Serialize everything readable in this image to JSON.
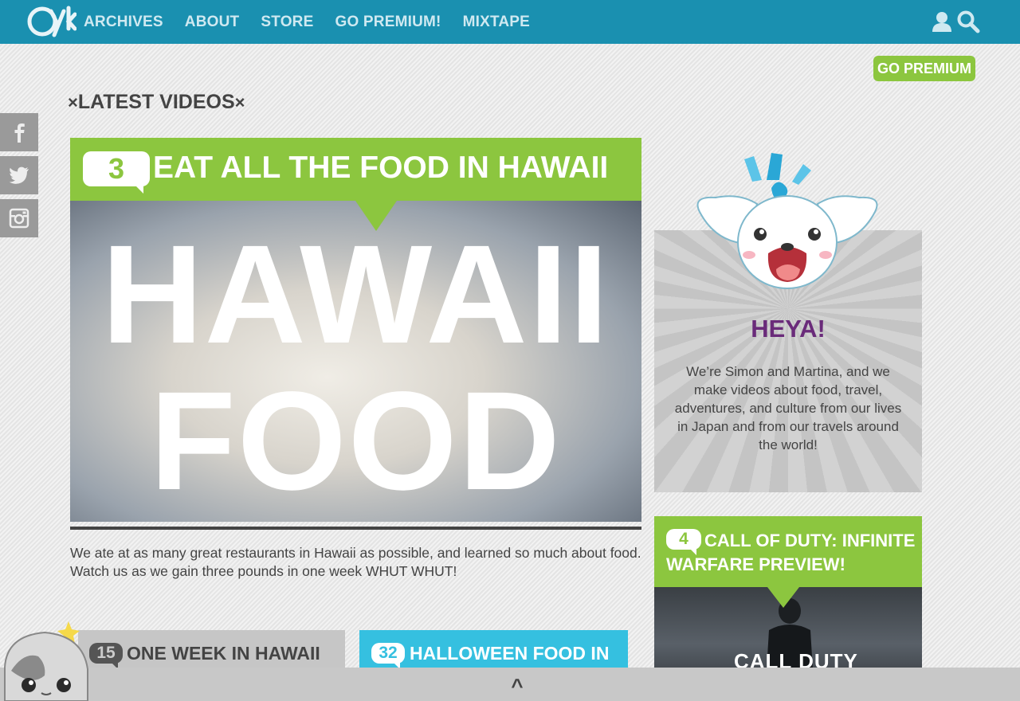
{
  "nav": {
    "logo_alt": "Zyk",
    "links": [
      "ARCHIVES",
      "ABOUT",
      "STORE",
      "GO PREMIUM!",
      "MIXTAPE"
    ],
    "icons": [
      "user-icon",
      "search-icon"
    ]
  },
  "premium_button": "GO PREMIUM",
  "section": {
    "title": "LATEST VIDEOS",
    "x_left": "×",
    "x_right": "×"
  },
  "social": [
    "facebook-icon",
    "twitter-icon",
    "instagram-icon"
  ],
  "featured": {
    "comments": "3",
    "title": "EAT ALL THE FOOD IN HAWAII",
    "image_text_1": "HAWAII",
    "image_text_2": "FOOD",
    "description": "We ate at as many great restaurants in Hawaii as possible, and learned so much about food. Watch us as we gain three pounds in one week WHUT WHUT!"
  },
  "cards": [
    {
      "comments": "15",
      "title": "ONE WEEK IN HAWAII"
    },
    {
      "comments": "32",
      "title": "HALLOWEEN FOOD IN"
    }
  ],
  "about": {
    "heading": "HEYA!",
    "text": "We’re Simon and Martina, and we make videos about food, travel, adventures, and culture from our lives in Japan and from our travels around the world!"
  },
  "side_video": {
    "comments": "4",
    "title": "CALL OF DUTY: INFINITE WARFARE PREVIEW!",
    "image_text": "CALL DUTY"
  },
  "bottom_bar": {
    "caret": "^"
  },
  "colors": {
    "nav_bg": "#1a90b0",
    "green": "#8cc63f",
    "blue": "#35c0e0",
    "purple": "#6a2b7a"
  }
}
